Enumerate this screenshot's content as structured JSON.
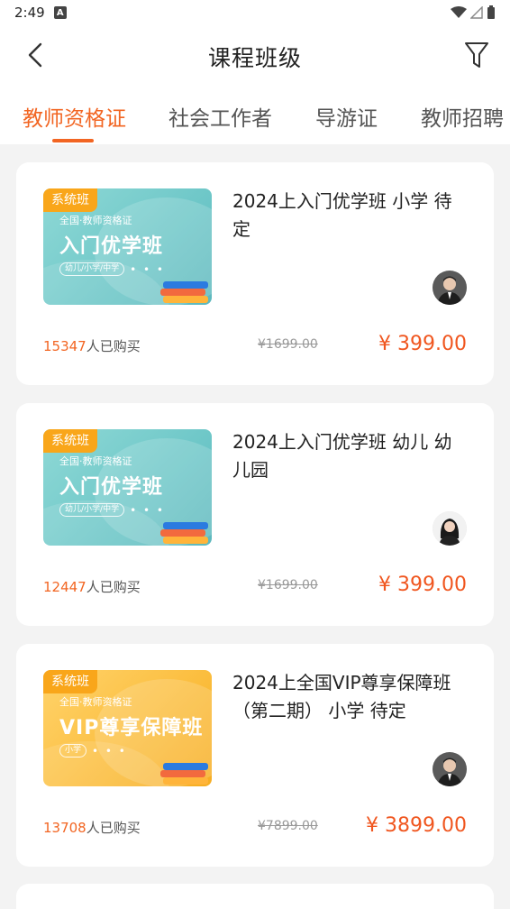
{
  "status_bar": {
    "time": "2:49",
    "notification_badge": "A"
  },
  "header": {
    "title": "课程班级"
  },
  "tabs": [
    {
      "label": "教师资格证",
      "active": true
    },
    {
      "label": "社会工作者",
      "active": false
    },
    {
      "label": "导游证",
      "active": false
    },
    {
      "label": "教师招聘",
      "active": false
    }
  ],
  "courses": [
    {
      "tag": "系统班",
      "cover_subtitle": "全国·教师资格证",
      "cover_title": "入门优学班",
      "cover_pill": "幼儿/小学/中学",
      "cover_dots": "• • •",
      "cover_theme": "teal",
      "title": "2024上入门优学班 小学 待定",
      "teacher_gender": "male",
      "buyer_count": "15347",
      "buyer_suffix": "人已购买",
      "original_price": "¥1699.00",
      "price": "¥ 399.00"
    },
    {
      "tag": "系统班",
      "cover_subtitle": "全国·教师资格证",
      "cover_title": "入门优学班",
      "cover_pill": "幼儿/小学/中学",
      "cover_dots": "• • •",
      "cover_theme": "teal",
      "title": "2024上入门优学班 幼儿 幼儿园",
      "teacher_gender": "female",
      "buyer_count": "12447",
      "buyer_suffix": "人已购买",
      "original_price": "¥1699.00",
      "price": "¥ 399.00"
    },
    {
      "tag": "系统班",
      "cover_subtitle": "全国·教师资格证",
      "cover_title": "VIP尊享保障班",
      "cover_pill": "小学",
      "cover_dots": "• • •",
      "cover_theme": "gold",
      "title": "2024上全国VIP尊享保障班（第二期） 小学 待定",
      "teacher_gender": "male",
      "buyer_count": "13708",
      "buyer_suffix": "人已购买",
      "original_price": "¥7899.00",
      "price": "¥ 3899.00"
    }
  ],
  "colors": {
    "accent": "#f26522",
    "price": "#f0561f",
    "tag": "#f9a61a",
    "background": "#f3f3f3"
  }
}
